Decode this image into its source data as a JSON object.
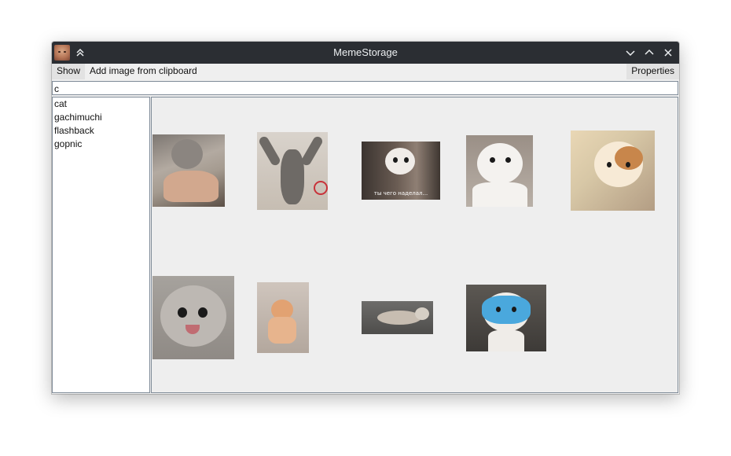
{
  "window": {
    "title": "MemeStorage",
    "colors": {
      "titlebar": "#2b2e33",
      "background": "#efefef",
      "border": "#7f8b98"
    }
  },
  "titlebar_icons": {
    "app": "cat-face-icon",
    "keep_above": "chevron-double-up-icon",
    "minimize": "chevron-down-icon",
    "maximize": "chevron-up-icon",
    "close": "close-icon"
  },
  "menu": {
    "show_label": "Show",
    "add_label": "Add image from clipboard",
    "properties_label": "Properties"
  },
  "search": {
    "value": "c"
  },
  "tags": [
    {
      "label": "cat"
    },
    {
      "label": "gachimuchi"
    },
    {
      "label": "flashback"
    },
    {
      "label": "gopnic"
    }
  ],
  "gallery": {
    "images": [
      {
        "name": "wet-cat"
      },
      {
        "name": "cat-arms-up"
      },
      {
        "name": "cat-caption",
        "caption": "ты чего наделал..."
      },
      {
        "name": "white-cat"
      },
      {
        "name": "anime-cat"
      },
      {
        "name": "kitten-surprised"
      },
      {
        "name": "ginger-kitten"
      },
      {
        "name": "lying-cat"
      },
      {
        "name": "cat-mask"
      }
    ]
  }
}
